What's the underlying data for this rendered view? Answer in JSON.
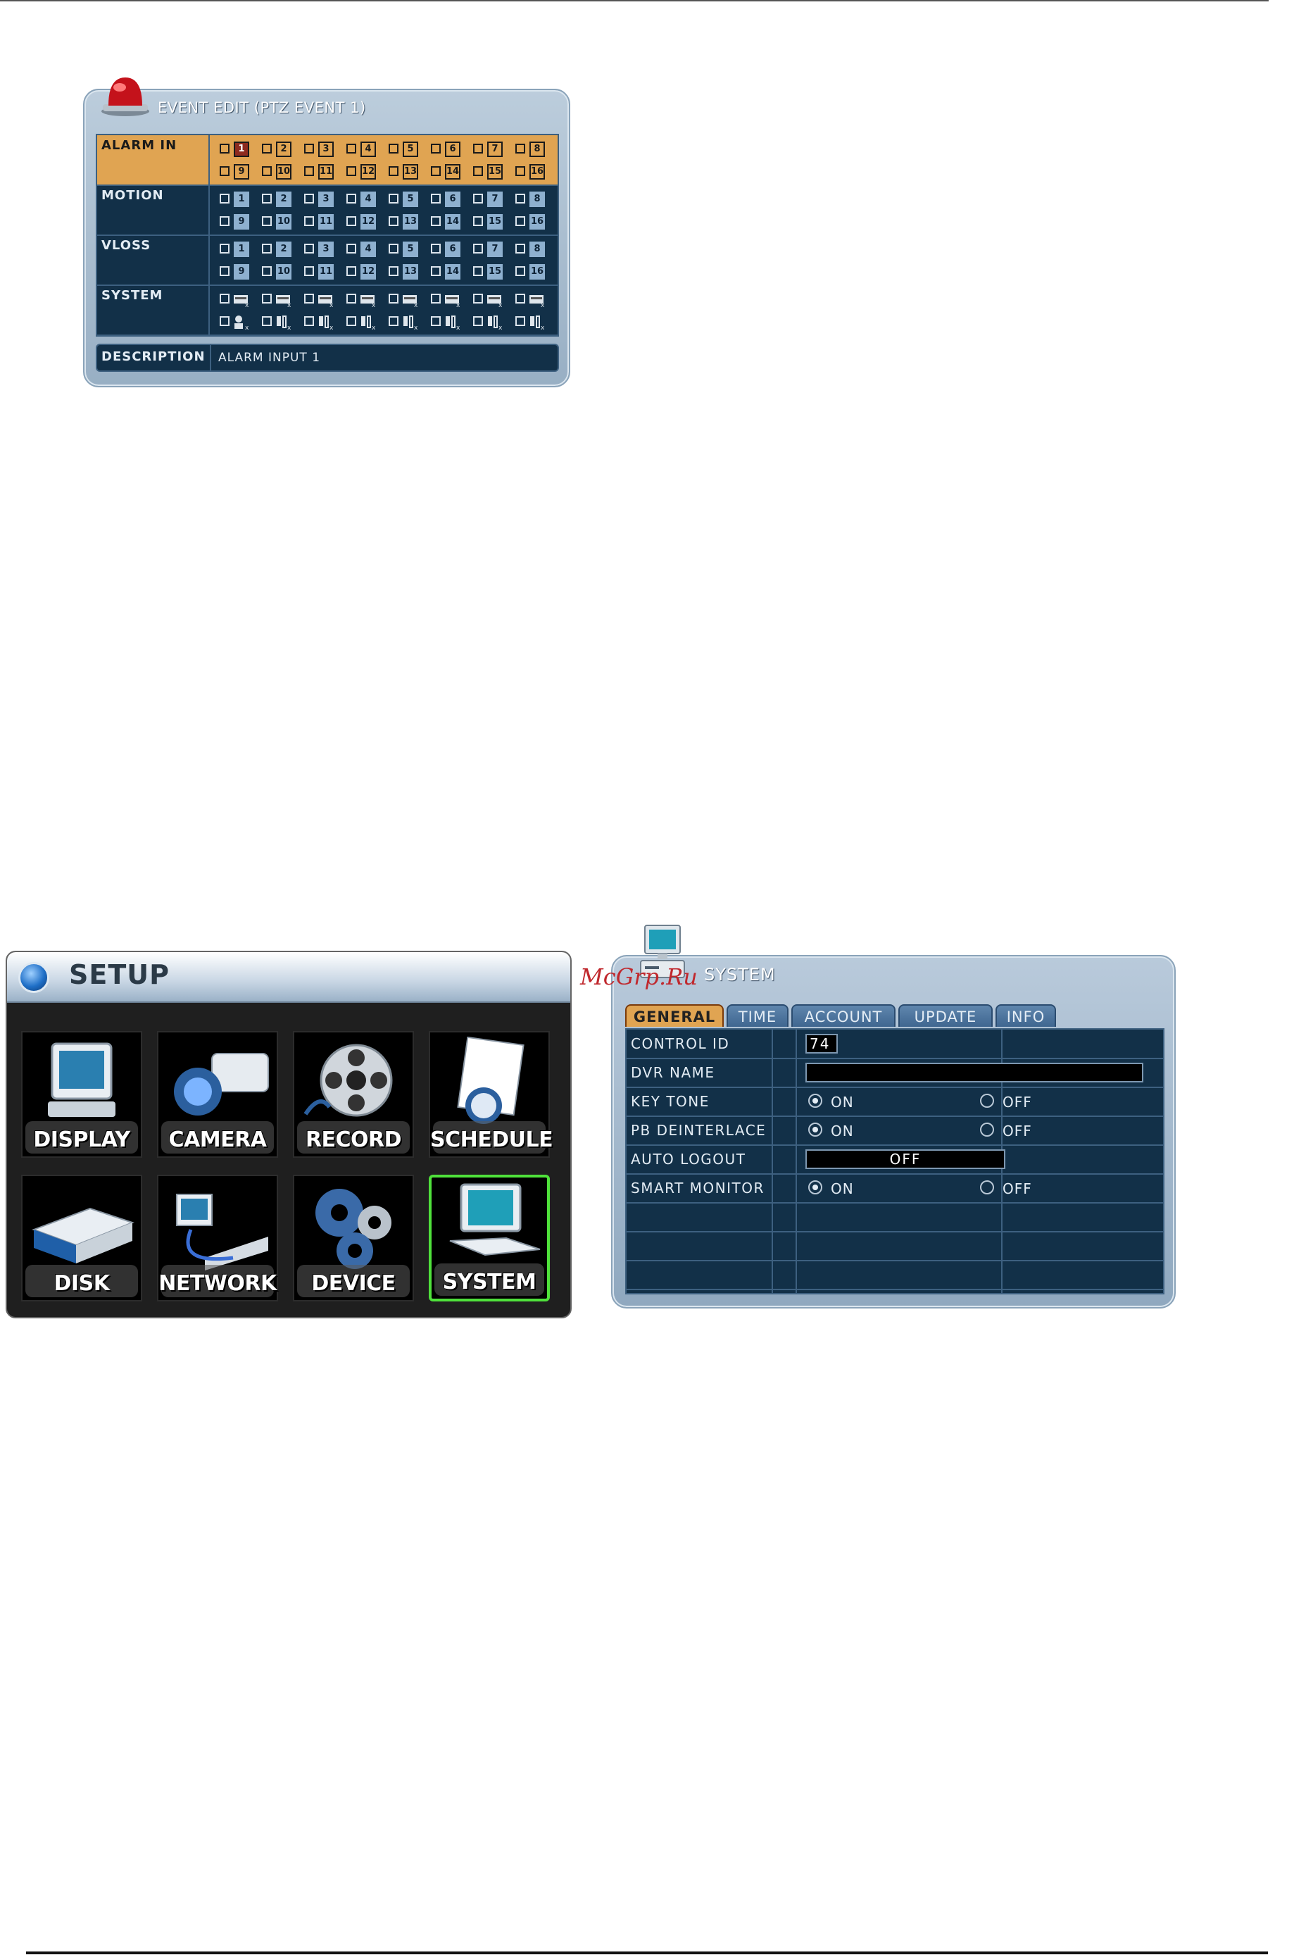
{
  "event_edit": {
    "title": "EVENT EDIT (PTZ EVENT 1)",
    "rows": [
      {
        "label": "ALARM IN",
        "numbers_top": [
          "1",
          "2",
          "3",
          "4",
          "5",
          "6",
          "7",
          "8"
        ],
        "numbers_bottom": [
          "9",
          "10",
          "11",
          "12",
          "13",
          "14",
          "15",
          "16"
        ],
        "selected": "1"
      },
      {
        "label": "MOTION",
        "numbers_top": [
          "1",
          "2",
          "3",
          "4",
          "5",
          "6",
          "7",
          "8"
        ],
        "numbers_bottom": [
          "9",
          "10",
          "11",
          "12",
          "13",
          "14",
          "15",
          "16"
        ]
      },
      {
        "label": "VLOSS",
        "numbers_top": [
          "1",
          "2",
          "3",
          "4",
          "5",
          "6",
          "7",
          "8"
        ],
        "numbers_bottom": [
          "9",
          "10",
          "11",
          "12",
          "13",
          "14",
          "15",
          "16"
        ]
      },
      {
        "label": "SYSTEM",
        "icons_top": [
          "disk-error-icon",
          "fan-error-icon",
          "disk-full-icon",
          "network-error-icon",
          "record-error-icon",
          "panel-error-icon",
          "hdd-nodisk-icon",
          "grid-error-icon"
        ],
        "icons_bottom": [
          "user-login-icon",
          "sensor-event-icon",
          "sensor-event-icon",
          "sensor-event-icon",
          "sensor-event-icon",
          "sensor-event-icon",
          "sensor-event-icon",
          "sensor-event-icon"
        ]
      }
    ],
    "description_label": "DESCRIPTION",
    "description_value": "ALARM INPUT 1",
    "colors": {
      "highlight": "#e0a452",
      "grid": "#123048",
      "selected": "#8e2b1f"
    }
  },
  "setup": {
    "title": "SETUP",
    "tiles": [
      {
        "label": "DISPLAY",
        "icon": "monitor-icon"
      },
      {
        "label": "CAMERA",
        "icon": "camera-icon"
      },
      {
        "label": "RECORD",
        "icon": "film-reel-icon"
      },
      {
        "label": "SCHEDULE",
        "icon": "schedule-notepad-icon"
      },
      {
        "label": "DISK",
        "icon": "disk-drive-icon"
      },
      {
        "label": "NETWORK",
        "icon": "network-icon"
      },
      {
        "label": "DEVICE",
        "icon": "gears-icon"
      },
      {
        "label": "SYSTEM",
        "icon": "computer-icon",
        "active": true
      }
    ],
    "colors": {
      "active_border": "#4fe13b"
    }
  },
  "system": {
    "title": "SYSTEM",
    "watermark": "McGrp.Ru",
    "tabs": [
      {
        "label": "GENERAL",
        "active": true
      },
      {
        "label": "TIME"
      },
      {
        "label": "ACCOUNT"
      },
      {
        "label": "UPDATE"
      },
      {
        "label": "INFO"
      }
    ],
    "rows": [
      {
        "label": "CONTROL ID",
        "value": "74"
      },
      {
        "label": "DVR NAME",
        "value": ""
      },
      {
        "label": "KEY TONE",
        "on": "ON",
        "off": "OFF",
        "selected": "ON"
      },
      {
        "label": "PB DEINTERLACE",
        "on": "ON",
        "off": "OFF",
        "selected": "ON"
      },
      {
        "label": "AUTO LOGOUT",
        "value": "OFF"
      },
      {
        "label": "SMART MONITOR",
        "on": "ON",
        "off": "OFF",
        "selected": "ON"
      }
    ]
  }
}
